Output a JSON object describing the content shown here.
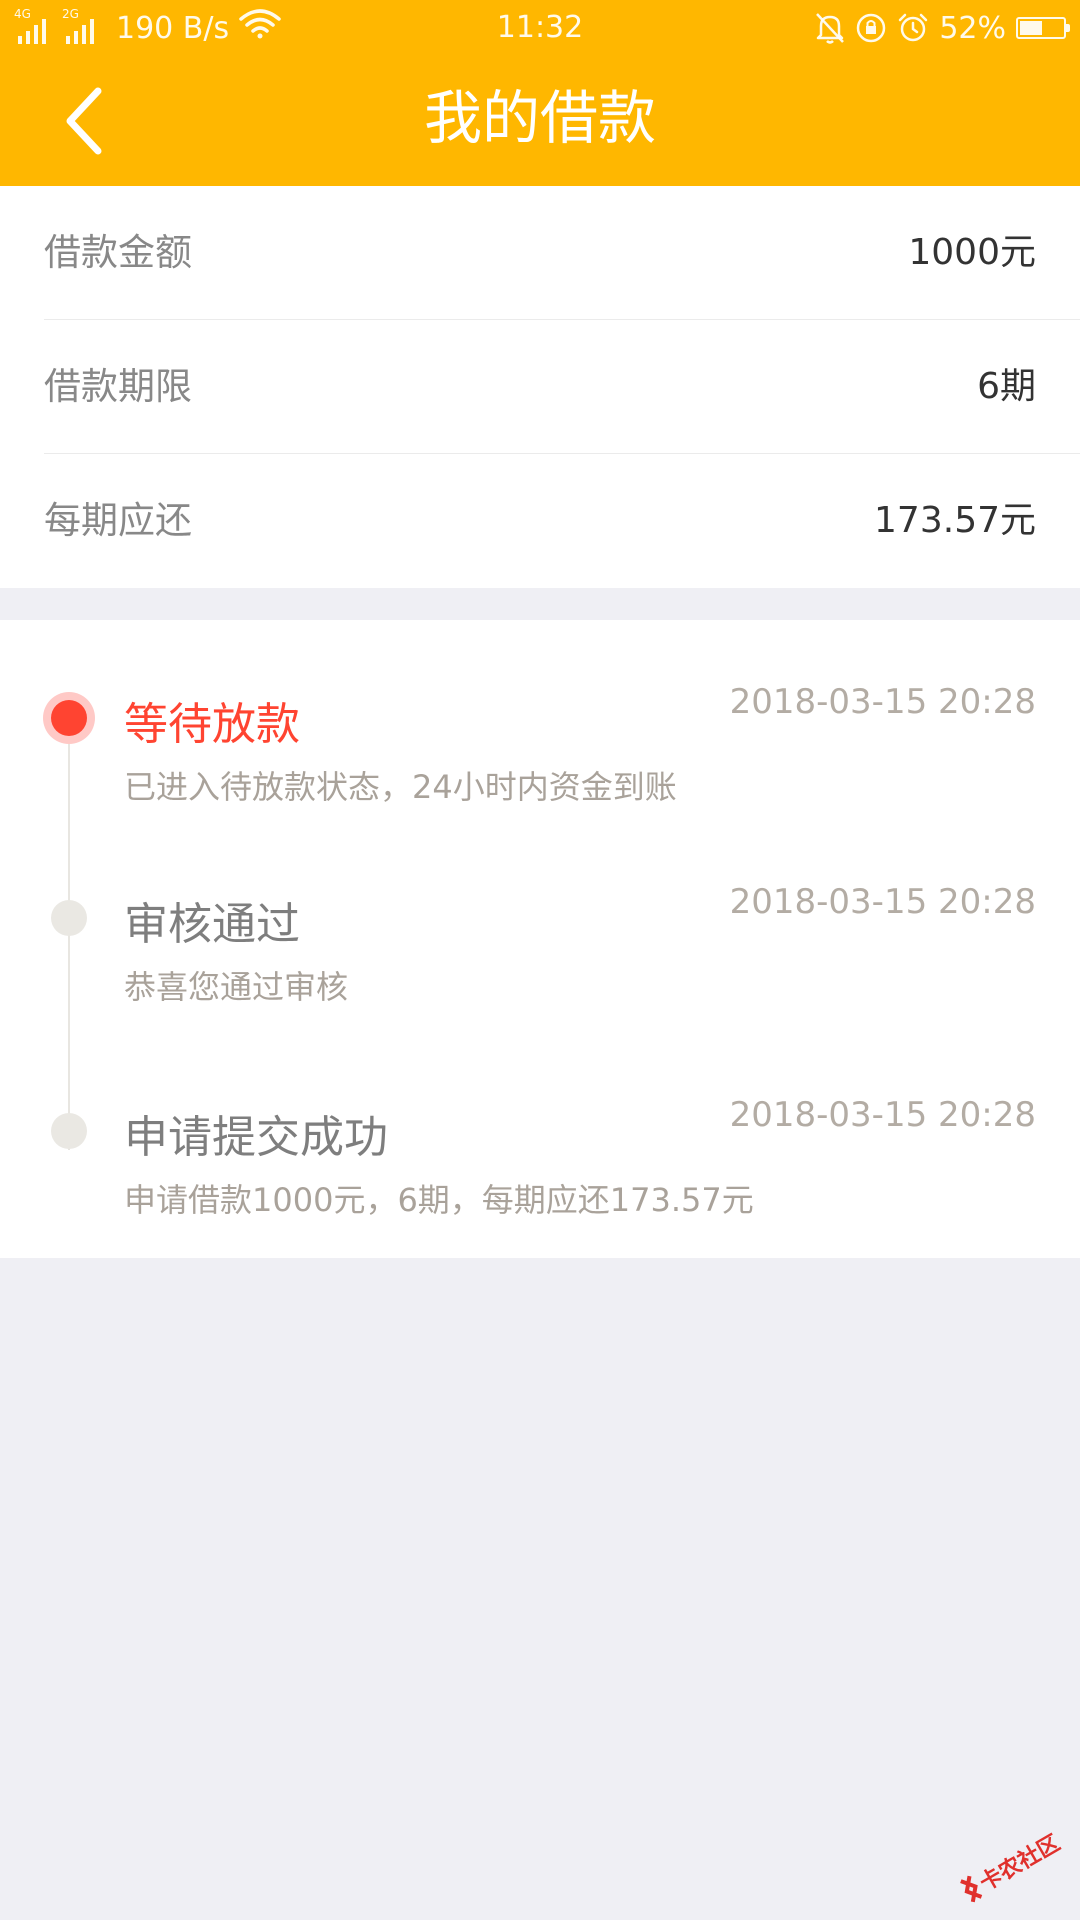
{
  "status_bar": {
    "network_1": "4G",
    "network_2": "2G",
    "speed": "190 B/s",
    "time": "11:32",
    "battery_percent": "52%",
    "battery_level": 0.52,
    "icons": [
      "signal-icon",
      "wifi-icon",
      "mute-icon",
      "rotation-lock-icon",
      "alarm-icon",
      "battery-icon"
    ]
  },
  "nav": {
    "title": "我的借款",
    "back_icon": "chevron-left-icon"
  },
  "loan_info": [
    {
      "label": "借款金额",
      "value": "1000元"
    },
    {
      "label": "借款期限",
      "value": "6期"
    },
    {
      "label": "每期应还",
      "value": "173.57元"
    }
  ],
  "timeline": [
    {
      "title": "等待放款",
      "desc": "已进入待放款状态，24小时内资金到账",
      "time": "2018-03-15 20:28",
      "active": true
    },
    {
      "title": "审核通过",
      "desc": "恭喜您通过审核",
      "time": "2018-03-15 20:28",
      "active": false
    },
    {
      "title": "申请提交成功",
      "desc": "申请借款1000元，6期，每期应还173.57元",
      "time": "2018-03-15 20:28",
      "active": false
    }
  ],
  "watermark": "卡农社区",
  "colors": {
    "header": "#ffb700",
    "active": "#ff4431",
    "background": "#efeff4"
  }
}
